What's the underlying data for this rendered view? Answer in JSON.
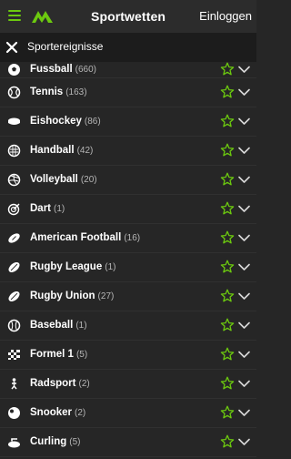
{
  "topbar": {
    "title": "Sportwetten",
    "login_label": "Einloggen"
  },
  "header": {
    "label": "Sportereignisse"
  },
  "colors": {
    "accent": "#6cc90f",
    "background": "#262626",
    "header_bg": "#1c1c1c"
  },
  "sports": [
    {
      "name": "Fussball",
      "count": "(660)",
      "icon": "football-icon"
    },
    {
      "name": "Tennis",
      "count": "(163)",
      "icon": "tennis-icon"
    },
    {
      "name": "Eishockey",
      "count": "(86)",
      "icon": "ice-hockey-icon"
    },
    {
      "name": "Handball",
      "count": "(42)",
      "icon": "handball-icon"
    },
    {
      "name": "Volleyball",
      "count": "(20)",
      "icon": "volleyball-icon"
    },
    {
      "name": "Dart",
      "count": "(1)",
      "icon": "darts-icon"
    },
    {
      "name": "American Football",
      "count": "(16)",
      "icon": "american-football-icon"
    },
    {
      "name": "Rugby League",
      "count": "(1)",
      "icon": "rugby-league-icon"
    },
    {
      "name": "Rugby Union",
      "count": "(27)",
      "icon": "rugby-union-icon"
    },
    {
      "name": "Baseball",
      "count": "(1)",
      "icon": "baseball-icon"
    },
    {
      "name": "Formel 1",
      "count": "(5)",
      "icon": "formula1-icon"
    },
    {
      "name": "Radsport",
      "count": "(2)",
      "icon": "cycling-icon"
    },
    {
      "name": "Snooker",
      "count": "(2)",
      "icon": "snooker-icon"
    },
    {
      "name": "Curling",
      "count": "(5)",
      "icon": "curling-icon"
    }
  ]
}
